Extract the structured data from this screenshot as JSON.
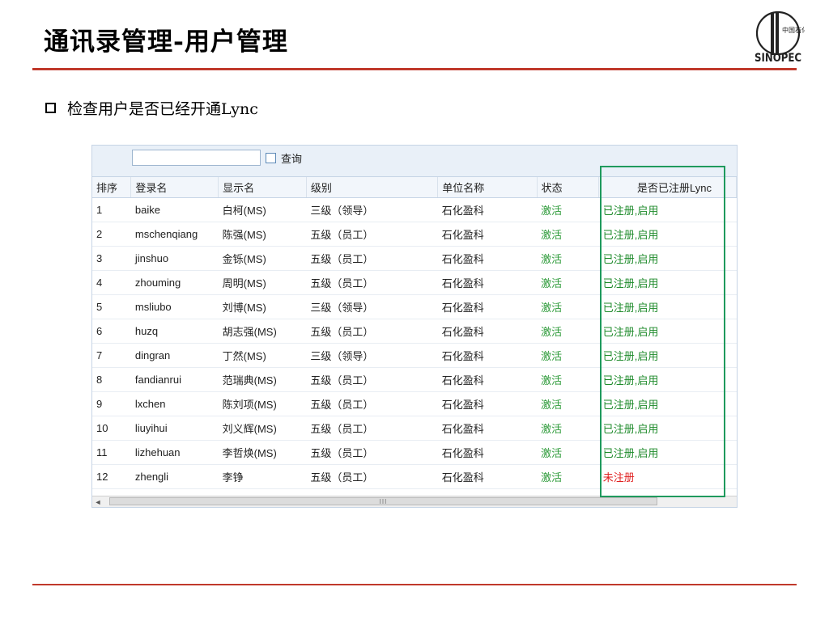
{
  "slide": {
    "title": "通讯录管理-用户管理",
    "bullet": "检查用户是否已经开通Lync",
    "logo_text": "SINOPEC",
    "logo_subtext": "中国石化",
    "accent_color": "#c0392b",
    "highlight_color": "#1f9a5d"
  },
  "grid": {
    "search": {
      "value": "",
      "button_label": "查询"
    },
    "columns": [
      "排序",
      "登录名",
      "显示名",
      "级别",
      "单位名称",
      "状态",
      "是否已注册Lync"
    ],
    "rows": [
      {
        "order": "1",
        "login": "baike",
        "display": "白柯(MS)",
        "level": "三级（领导）",
        "unit": "石化盈科",
        "status": "激活",
        "lync": "已注册,启用",
        "lync_state": "green"
      },
      {
        "order": "2",
        "login": "mschenqiang",
        "display": "陈强(MS)",
        "level": "五级（员工）",
        "unit": "石化盈科",
        "status": "激活",
        "lync": "已注册,启用",
        "lync_state": "green"
      },
      {
        "order": "3",
        "login": "jinshuo",
        "display": "金铄(MS)",
        "level": "五级（员工）",
        "unit": "石化盈科",
        "status": "激活",
        "lync": "已注册,启用",
        "lync_state": "green"
      },
      {
        "order": "4",
        "login": "zhouming",
        "display": "周明(MS)",
        "level": "五级（员工）",
        "unit": "石化盈科",
        "status": "激活",
        "lync": "已注册,启用",
        "lync_state": "green"
      },
      {
        "order": "5",
        "login": "msliubo",
        "display": "刘博(MS)",
        "level": "三级（领导）",
        "unit": "石化盈科",
        "status": "激活",
        "lync": "已注册,启用",
        "lync_state": "green"
      },
      {
        "order": "6",
        "login": "huzq",
        "display": "胡志强(MS)",
        "level": "五级（员工）",
        "unit": "石化盈科",
        "status": "激活",
        "lync": "已注册,启用",
        "lync_state": "green"
      },
      {
        "order": "7",
        "login": "dingran",
        "display": "丁然(MS)",
        "level": "三级（领导）",
        "unit": "石化盈科",
        "status": "激活",
        "lync": "已注册,启用",
        "lync_state": "green"
      },
      {
        "order": "8",
        "login": "fandianrui",
        "display": "范瑞典(MS)",
        "level": "五级（员工）",
        "unit": "石化盈科",
        "status": "激活",
        "lync": "已注册,启用",
        "lync_state": "green"
      },
      {
        "order": "9",
        "login": "lxchen",
        "display": "陈刘项(MS)",
        "level": "五级（员工）",
        "unit": "石化盈科",
        "status": "激活",
        "lync": "已注册,启用",
        "lync_state": "green"
      },
      {
        "order": "10",
        "login": "liuyihui",
        "display": "刘义辉(MS)",
        "level": "五级（员工）",
        "unit": "石化盈科",
        "status": "激活",
        "lync": "已注册,启用",
        "lync_state": "green"
      },
      {
        "order": "11",
        "login": "lizhehuan",
        "display": "李哲焕(MS)",
        "level": "五级（员工）",
        "unit": "石化盈科",
        "status": "激活",
        "lync": "已注册,启用",
        "lync_state": "green"
      },
      {
        "order": "12",
        "login": "zhengli",
        "display": "李铮",
        "level": "五级（员工）",
        "unit": "石化盈科",
        "status": "激活",
        "lync": "未注册",
        "lync_state": "red"
      }
    ],
    "scrollbar": {
      "left_arrow": "◄",
      "thumb_grip": "III"
    }
  }
}
